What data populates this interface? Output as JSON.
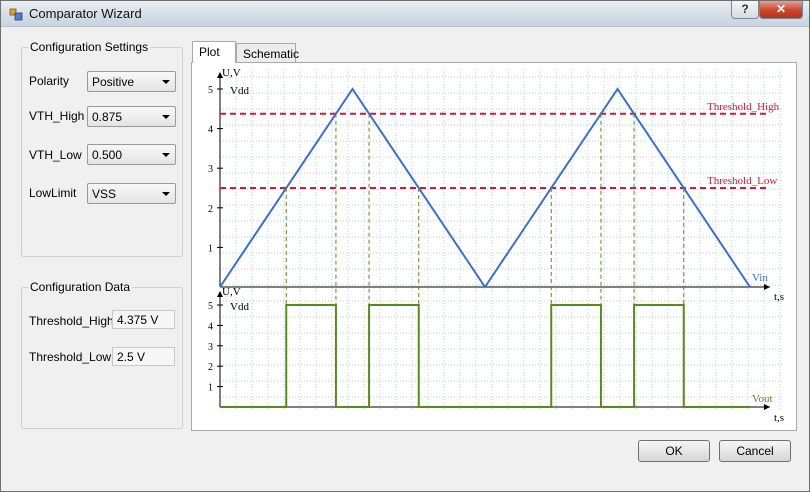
{
  "window": {
    "title": "Comparator Wizard",
    "help_label": "?",
    "close_label": "✕"
  },
  "config_settings": {
    "title": "Configuration Settings",
    "fields": [
      {
        "label": "Polarity",
        "value": "Positive"
      },
      {
        "label": "VTH_High",
        "value": "0.875"
      },
      {
        "label": "VTH_Low",
        "value": "0.500"
      },
      {
        "label": "LowLimit",
        "value": "VSS"
      }
    ]
  },
  "config_data": {
    "title": "Configuration Data",
    "fields": [
      {
        "label": "Threshold_High",
        "value": "4.375 V"
      },
      {
        "label": "Threshold_Low",
        "value": "2.5 V"
      }
    ]
  },
  "tabs": [
    {
      "label": "Plot"
    },
    {
      "label": "Schematic"
    }
  ],
  "buttons": {
    "ok": "OK",
    "cancel": "Cancel"
  },
  "chart_data": [
    {
      "type": "line",
      "ylabel": "U,V",
      "xlabel": "t,s",
      "ylim": [
        0,
        5
      ],
      "yticks": [
        "1",
        "2",
        "3",
        "4",
        "5"
      ],
      "vdd_label": "Vdd",
      "grid": true,
      "series": [
        {
          "name": "Vin",
          "color": "#3a6fd0",
          "x": [
            0,
            6.4,
            12.8,
            19.2,
            25.6
          ],
          "y": [
            0,
            5,
            0,
            5,
            0
          ]
        }
      ],
      "thresholds": [
        {
          "name": "Threshold_High",
          "value": 4.375,
          "color": "#d0183c"
        },
        {
          "name": "Threshold_Low",
          "value": 2.5,
          "color": "#d0183c"
        }
      ]
    },
    {
      "type": "line",
      "ylabel": "U,V",
      "xlabel": "t,s",
      "ylim": [
        0,
        5
      ],
      "yticks": [
        "1",
        "2",
        "3",
        "4",
        "5"
      ],
      "vdd_label": "Vdd",
      "grid": true,
      "series": [
        {
          "name": "Vout",
          "color": "#5a8a1e",
          "x": [
            0,
            3.2,
            3.2,
            5.6,
            5.6,
            7.2,
            7.2,
            9.6,
            9.6,
            16.0,
            16.0,
            18.4,
            18.4,
            20.0,
            20.0,
            22.4,
            22.4,
            25.6
          ],
          "y": [
            0,
            0,
            5,
            5,
            0,
            0,
            5,
            5,
            0,
            0,
            5,
            5,
            0,
            0,
            5,
            5,
            0,
            0
          ]
        }
      ]
    }
  ]
}
